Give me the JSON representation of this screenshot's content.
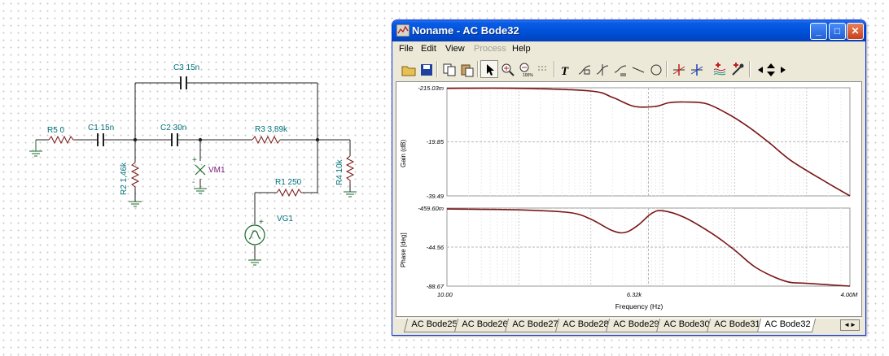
{
  "schematic": {
    "components": {
      "r5": "R5 0",
      "c1": "C1 15n",
      "c3": "C3 15n",
      "c2": "C2 30n",
      "r3": "R3 3,89k",
      "r2": "R2 1,46k",
      "vm1": "VM1",
      "r4": "R4 10k",
      "r1": "R1 250",
      "vg1": "VG1"
    },
    "polarity": {
      "vm_plus": "+",
      "vm_minus": "-",
      "vg_plus": "+"
    },
    "colors": {
      "label": "#00727a",
      "meter": "#7a1a7a",
      "wire": "#202020",
      "ground": "#1a6a2a"
    }
  },
  "window": {
    "title": "Noname - AC Bode32",
    "controls": {
      "minimize": "_",
      "maximize": "□",
      "close": "✕"
    },
    "menu": [
      {
        "label": "File",
        "enabled": true
      },
      {
        "label": "Edit",
        "enabled": true
      },
      {
        "label": "View",
        "enabled": true
      },
      {
        "label": "Process",
        "enabled": false
      },
      {
        "label": "Help",
        "enabled": true
      }
    ],
    "toolbar_icons": [
      "open-folder-icon",
      "save-disk-icon",
      "copy-icon",
      "paste-icon",
      "arrow-pointer-icon",
      "zoom-in-icon",
      "zoom-100-icon",
      "grid-icon",
      "text-tool-icon",
      "curve-label-icon",
      "marker-icon",
      "marker-list-icon",
      "line-tool-icon",
      "circle-tool-icon",
      "cursor-a-icon",
      "cursor-b-icon",
      "add-curve-icon",
      "color-picker-icon",
      "arrow-left-icon",
      "arrow-updown-icon",
      "arrow-right-icon"
    ],
    "tabs": [
      {
        "label": "AC Bode25",
        "active": false
      },
      {
        "label": "AC Bode26",
        "active": false
      },
      {
        "label": "AC Bode27",
        "active": false
      },
      {
        "label": "AC Bode28",
        "active": false
      },
      {
        "label": "AC Bode29",
        "active": false
      },
      {
        "label": "AC Bode30",
        "active": false
      },
      {
        "label": "AC Bode31",
        "active": false
      },
      {
        "label": "AC Bode32",
        "active": true
      }
    ]
  },
  "chart_data": [
    {
      "type": "line",
      "ylabel": "Gain (dB)",
      "xlabel": "",
      "x_scale": "log",
      "xlim": [
        10,
        4000000
      ],
      "ylim": [
        -39.49,
        -0.000215
      ],
      "y_ticks": [
        "-215.03m",
        "-19.85",
        "-39.49"
      ],
      "grid": true,
      "series": [
        {
          "color": "#7a1515",
          "x": [
            10,
            100,
            1000,
            2000,
            4000,
            8000,
            12000,
            20000,
            40000,
            80000,
            150000,
            300000,
            600000,
            1500000,
            4000000
          ],
          "y": [
            -0.2,
            -0.2,
            -1.2,
            -3.5,
            -6.8,
            -6.8,
            -5.5,
            -5.2,
            -5.8,
            -9.5,
            -14,
            -20,
            -26.5,
            -33,
            -39.49
          ]
        }
      ]
    },
    {
      "type": "line",
      "ylabel": "Phase [deg]",
      "xlabel": "Frequency (Hz)",
      "x_scale": "log",
      "xlim": [
        10,
        4000000
      ],
      "ylim": [
        -88.67,
        -0.4596
      ],
      "y_ticks": [
        "-459.60m",
        "-44.56",
        "-88.67"
      ],
      "x_ticks": [
        "10.00",
        "6.32k",
        "4.00M"
      ],
      "grid": true,
      "series": [
        {
          "color": "#7a1515",
          "x": [
            10,
            100,
            500,
            1000,
            2000,
            3000,
            4500,
            7000,
            10000,
            20000,
            50000,
            100000,
            200000,
            500000,
            1000000,
            4000000
          ],
          "y": [
            -1.5,
            -2.5,
            -5.5,
            -13,
            -26,
            -28,
            -20,
            -6.5,
            -3.5,
            -11,
            -30,
            -48,
            -68,
            -83,
            -85.5,
            -88.67
          ]
        }
      ]
    }
  ]
}
